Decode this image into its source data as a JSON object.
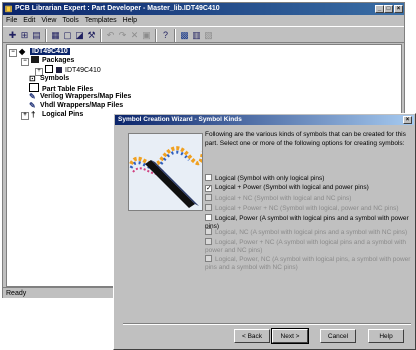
{
  "app": {
    "title": "PCB Librarian Expert : Part Developer - Master_lib.IDT49C410"
  },
  "menu": [
    "File",
    "Edit",
    "View",
    "Tools",
    "Templates",
    "Help"
  ],
  "tree": {
    "root": "IDT49C410",
    "packages": "Packages",
    "package_child": "IDT49C410",
    "symbols": "Symbols",
    "part_table": "Part Table Files",
    "verilog": "Verilog Wrappers/Map Files",
    "vhdl": "Vhdl Wrappers/Map Files",
    "logical_pins": "Logical Pins"
  },
  "status": "Ready",
  "dialog": {
    "title": "Symbol Creation Wizard - Symbol Kinds",
    "intro": "Following are the various kinds of symbols that can be created for this part. Select one or more of the following options for creating symbols:",
    "options": [
      {
        "label": "Logical (Symbol with only logical pins)",
        "checked": false,
        "enabled": true
      },
      {
        "label": "Logical + Power (Symbol with logical and power pins)",
        "checked": true,
        "enabled": true
      },
      {
        "label": "Logical + NC (Symbol with logical and NC pins)",
        "checked": false,
        "enabled": false
      },
      {
        "label": "Logical + Power + NC (Symbol with logical, power and NC pins)",
        "checked": false,
        "enabled": false
      },
      {
        "label": "Logical, Power (A symbol with logical pins and a symbol with power pins)",
        "checked": false,
        "enabled": true
      },
      {
        "label": "Logical, NC (A symbol with logical pins and a symbol with NC pins)",
        "checked": false,
        "enabled": false
      },
      {
        "label": "Logical, Power + NC (A symbol with logical pins and a symbol with power and NC pins)",
        "checked": false,
        "enabled": false
      },
      {
        "label": "Logical, Power, NC (A symbol with logical pins, a symbol with power pins and a symbol with NC pins)",
        "checked": false,
        "enabled": false
      }
    ],
    "buttons": {
      "back": "< Back",
      "next": "Next >",
      "cancel": "Cancel",
      "help": "Help"
    }
  },
  "icons": [
    "new-icon",
    "open-icon",
    "save-icon",
    "package-icon",
    "symbol-icon",
    "chart-icon",
    "tools-icon",
    "undo-icon",
    "redo-icon",
    "cut-icon",
    "paste-icon",
    "help-icon",
    "view1-icon",
    "view2-icon",
    "view3-icon"
  ],
  "colors": {
    "titlebar": "#0a246a",
    "face": "#c0c0c0",
    "selection": "#0a246a"
  }
}
